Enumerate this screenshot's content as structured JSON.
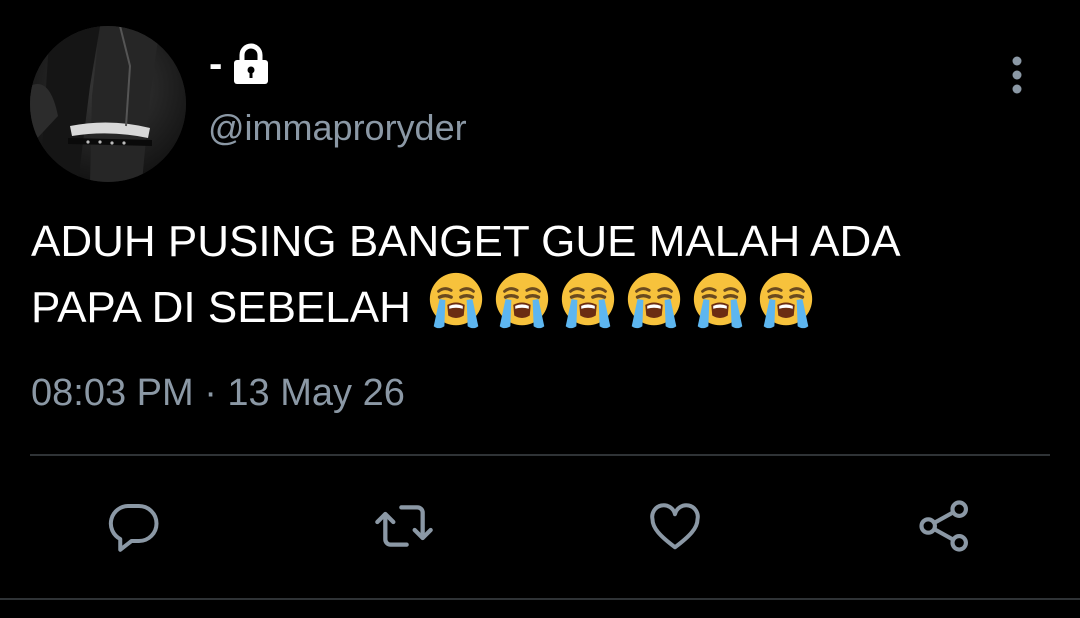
{
  "tweet": {
    "author": {
      "display_name": "-",
      "handle": "@immaproryder",
      "protected_icon": "lock-icon",
      "avatar": "user-avatar"
    },
    "text_line_1": "ADUH PUSING BANGET GUE MALAH ADA",
    "text_line_2": "PAPA DI SEBELAH",
    "emoji": [
      "loudly-crying-face",
      "loudly-crying-face",
      "loudly-crying-face",
      "loudly-crying-face",
      "loudly-crying-face",
      "loudly-crying-face"
    ],
    "timestamp": "08:03 PM · 13 May 26"
  },
  "menu": {
    "icon": "more-vertical-icon"
  },
  "actions": [
    {
      "name": "reply",
      "icon": "comment-icon"
    },
    {
      "name": "retweet",
      "icon": "retweet-icon"
    },
    {
      "name": "like",
      "icon": "heart-icon"
    },
    {
      "name": "share",
      "icon": "share-icon"
    }
  ],
  "colors": {
    "background": "#000000",
    "text": "#ffffff",
    "muted": "#8b98a5",
    "divider": "#2f3336",
    "emoji_face": "#f7c23c",
    "emoji_tears": "#5db6f0"
  }
}
